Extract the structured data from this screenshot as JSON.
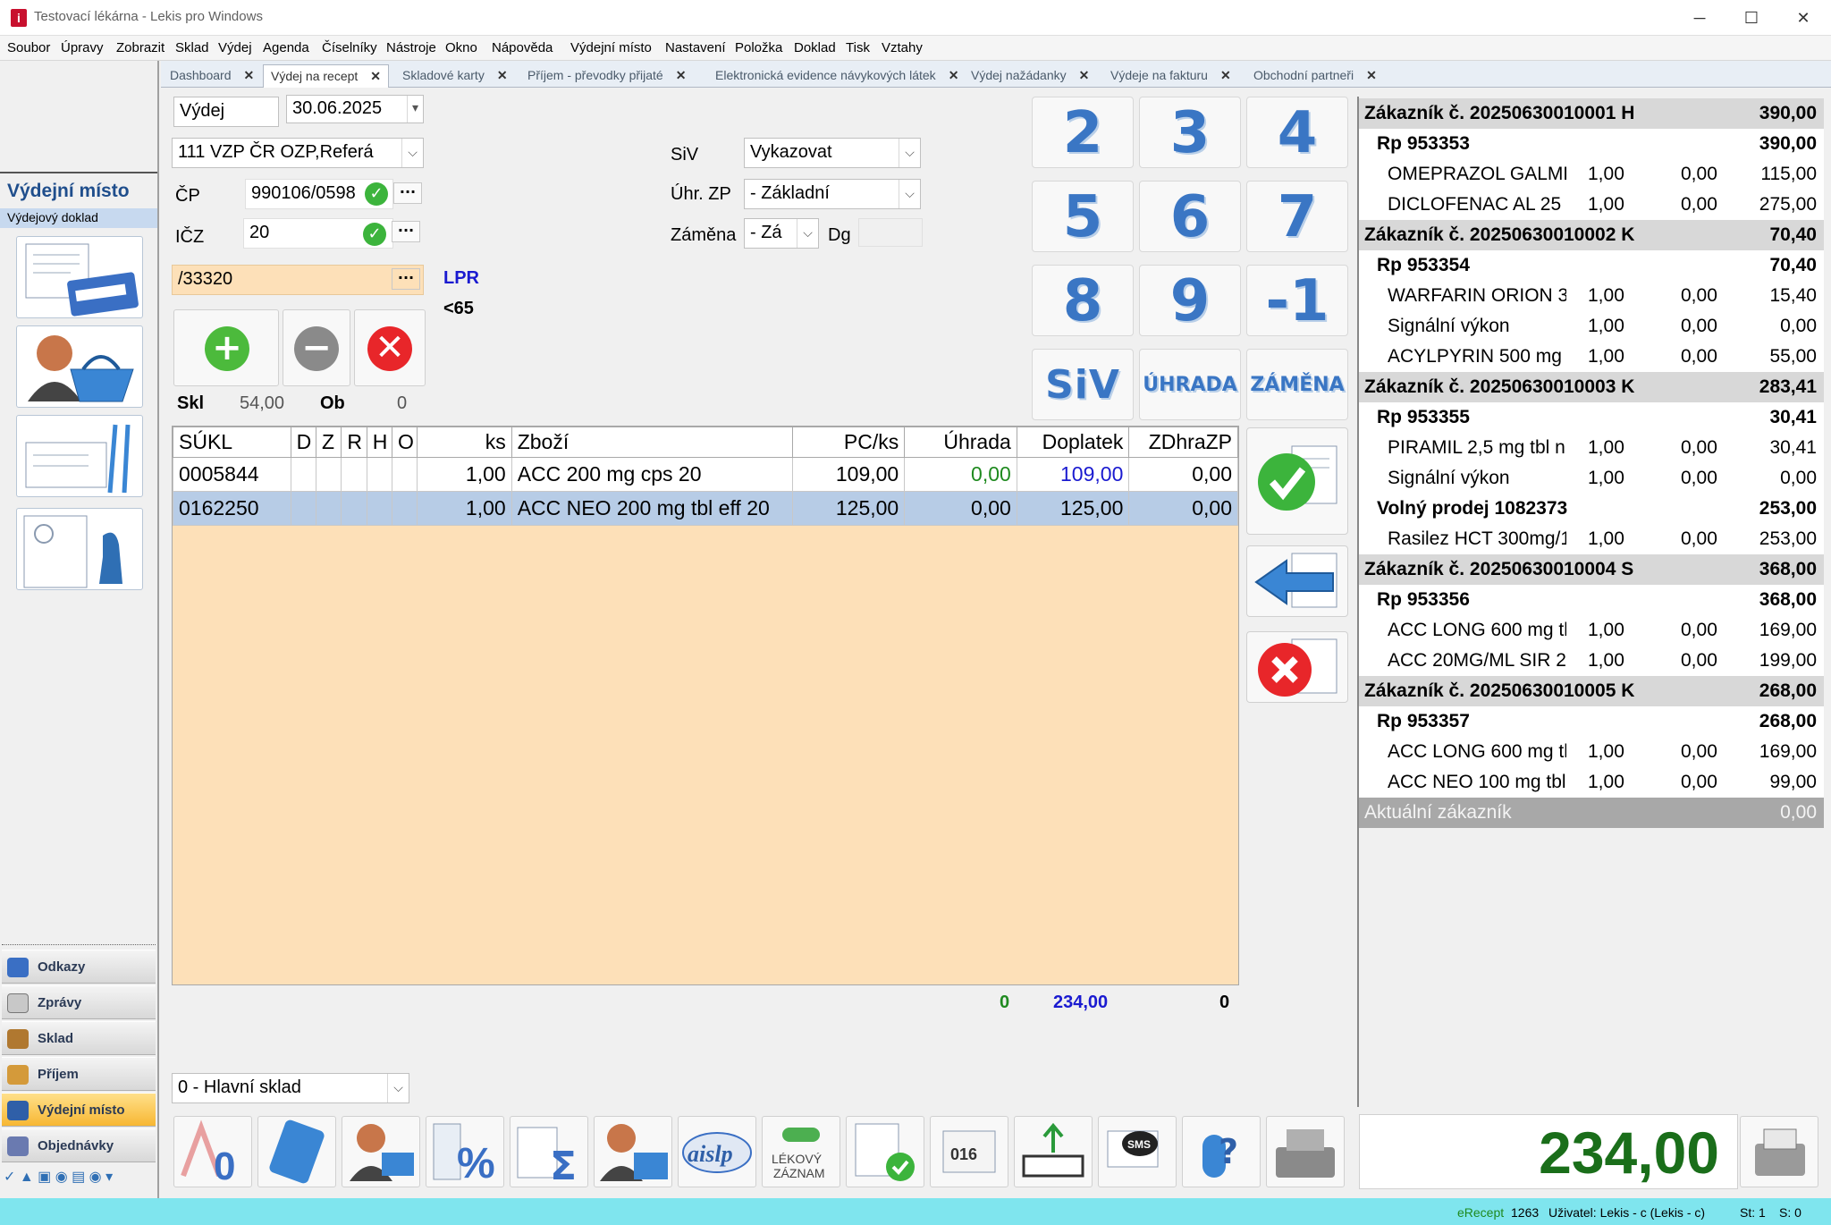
{
  "window": {
    "title": "Testovací lékárna -  Lekis pro Windows",
    "minimize": "─",
    "maximize": "☐",
    "close": "✕"
  },
  "menu": [
    "Soubor",
    "Úpravy",
    "Zobrazit",
    "Sklad",
    "Výdej",
    "Agenda",
    "Číselníky",
    "Nástroje",
    "Okno",
    "Nápověda",
    "Výdejní místo",
    "Nastavení",
    "Položka",
    "Doklad",
    "Tisk",
    "Vztahy"
  ],
  "left": {
    "title": "Výdejní místo",
    "subtitle": "Výdejový doklad",
    "nav": [
      "Odkazy",
      "Zprávy",
      "Sklad",
      "Příjem",
      "Výdejní místo",
      "Objednávky"
    ]
  },
  "tabs": [
    {
      "label": "Dashboard"
    },
    {
      "label": "Výdej na recept"
    },
    {
      "label": "Skladové karty"
    },
    {
      "label": "Příjem - převodky přijaté"
    },
    {
      "label": "Elektronická evidence návykových látek"
    },
    {
      "label": "Výdej nažádanky"
    },
    {
      "label": "Výdeje na fakturu"
    },
    {
      "label": "Obchodní partneři"
    }
  ],
  "form": {
    "vydej": "Výdej",
    "date": "30.06.2025",
    "insurer": "111 VZP ČR  OZP,Referá",
    "cp_label": "ČP",
    "cp_value": "990106/0598",
    "icz_label": "IČZ",
    "icz_value": "20",
    "prescriber": "/33320",
    "lpr": "LPR",
    "age": "<65",
    "skl_label": "Skl",
    "skl_value": "54,00",
    "ob_label": "Ob",
    "ob_value": "0",
    "siv_label": "SiV",
    "siv_value": "Vykazovat",
    "uhr_label": "Úhr. ZP",
    "uhr_value": "- Základní",
    "zamena_label": "Záměna",
    "zamena_value": "- Zá",
    "dg_label": "Dg",
    "warehouse": "0 - Hlavní sklad"
  },
  "keypad": [
    "2",
    "3",
    "4",
    "5",
    "6",
    "7",
    "8",
    "9",
    "-1",
    "SiV",
    "ÚHRADA",
    "ZÁMĚNA"
  ],
  "grid": {
    "columns": [
      "SÚKL",
      "D",
      "Z",
      "R",
      "H",
      "O",
      "ks",
      "Zboží",
      "PC/ks",
      "Úhrada",
      "Doplatek",
      "ZDhraZP"
    ],
    "rows": [
      [
        "0005844",
        "",
        "",
        "",
        "",
        "",
        "1,00",
        "ACC 200 mg cps 20",
        "109,00",
        "0,00",
        "109,00",
        "0,00"
      ],
      [
        "0162250",
        "",
        "",
        "",
        "",
        "",
        "1,00",
        "ACC NEO 200 mg tbl eff 20",
        "125,00",
        "0,00",
        "125,00",
        "0,00"
      ]
    ],
    "totals": {
      "uhrada": "0",
      "doplatek": "234,00",
      "zdhra": "0"
    }
  },
  "customers": [
    {
      "type": "hdr",
      "name": "Zákazník č. 20250630010001 H",
      "amount": "390,00"
    },
    {
      "type": "rp",
      "name": "Rp 953353",
      "amount": "390,00"
    },
    {
      "type": "it",
      "name": "OMEPRAZOL GALMEI",
      "qty": "1,00",
      "x": "0,00",
      "amount": "115,00"
    },
    {
      "type": "it",
      "name": "DICLOFENAC AL 25 r",
      "qty": "1,00",
      "x": "0,00",
      "amount": "275,00"
    },
    {
      "type": "hdr",
      "name": "Zákazník č. 20250630010002 K",
      "amount": "70,40"
    },
    {
      "type": "rp",
      "name": "Rp 953354",
      "amount": "70,40"
    },
    {
      "type": "it",
      "name": "WARFARIN ORION 3",
      "qty": "1,00",
      "x": "0,00",
      "amount": "15,40"
    },
    {
      "type": "it",
      "name": "Signální výkon",
      "qty": "1,00",
      "x": "0,00",
      "amount": "0,00"
    },
    {
      "type": "it",
      "name": "ACYLPYRIN 500 mg t",
      "qty": "1,00",
      "x": "0,00",
      "amount": "55,00"
    },
    {
      "type": "hdr",
      "name": "Zákazník č. 20250630010003 K",
      "amount": "283,41"
    },
    {
      "type": "rp",
      "name": "Rp 953355",
      "amount": "30,41"
    },
    {
      "type": "it",
      "name": "PIRAMIL 2,5 mg tbl n",
      "qty": "1,00",
      "x": "0,00",
      "amount": "30,41"
    },
    {
      "type": "it",
      "name": "Signální výkon",
      "qty": "1,00",
      "x": "0,00",
      "amount": "0,00"
    },
    {
      "type": "rp",
      "name": "Volný prodej 1082373",
      "amount": "253,00"
    },
    {
      "type": "it",
      "name": "Rasilez HCT 300mg/1",
      "qty": "1,00",
      "x": "0,00",
      "amount": "253,00"
    },
    {
      "type": "hdr",
      "name": "Zákazník č. 20250630010004 S",
      "amount": "368,00"
    },
    {
      "type": "rp",
      "name": "Rp 953356",
      "amount": "368,00"
    },
    {
      "type": "it",
      "name": "ACC LONG 600 mg tb",
      "qty": "1,00",
      "x": "0,00",
      "amount": "169,00"
    },
    {
      "type": "it",
      "name": "ACC 20MG/ML SIR 2(",
      "qty": "1,00",
      "x": "0,00",
      "amount": "199,00"
    },
    {
      "type": "hdr",
      "name": "Zákazník č. 20250630010005 K",
      "amount": "268,00"
    },
    {
      "type": "rp",
      "name": "Rp 953357",
      "amount": "268,00"
    },
    {
      "type": "it",
      "name": "ACC LONG 600 mg tb",
      "qty": "1,00",
      "x": "0,00",
      "amount": "169,00"
    },
    {
      "type": "it",
      "name": "ACC NEO 100 mg tbl",
      "qty": "1,00",
      "x": "0,00",
      "amount": "99,00"
    },
    {
      "type": "cur",
      "name": "Aktuální zákazník",
      "amount": "0,00"
    }
  ],
  "total": "234,00",
  "toolbar": [
    "zero-price",
    "calculator",
    "customer-card",
    "discount-percent",
    "sum-documents",
    "customer-insurance",
    "aislp",
    "lekovy-zaznam",
    "approve-document",
    "016",
    "export",
    "sms",
    "help-capsule",
    "cash-register"
  ],
  "toolbar_labels": {
    "t016": "016",
    "aislp": "aislp",
    "lz1": "LÉKOVÝ",
    "lz2": "ZÁZNAM",
    "sms": "SMS"
  },
  "status": {
    "erecept": "eRecept",
    "count": "1263",
    "user": "Uživatel: Lekis - c (Lekis - c)",
    "st": "St: 1",
    "s": "S: 0"
  }
}
